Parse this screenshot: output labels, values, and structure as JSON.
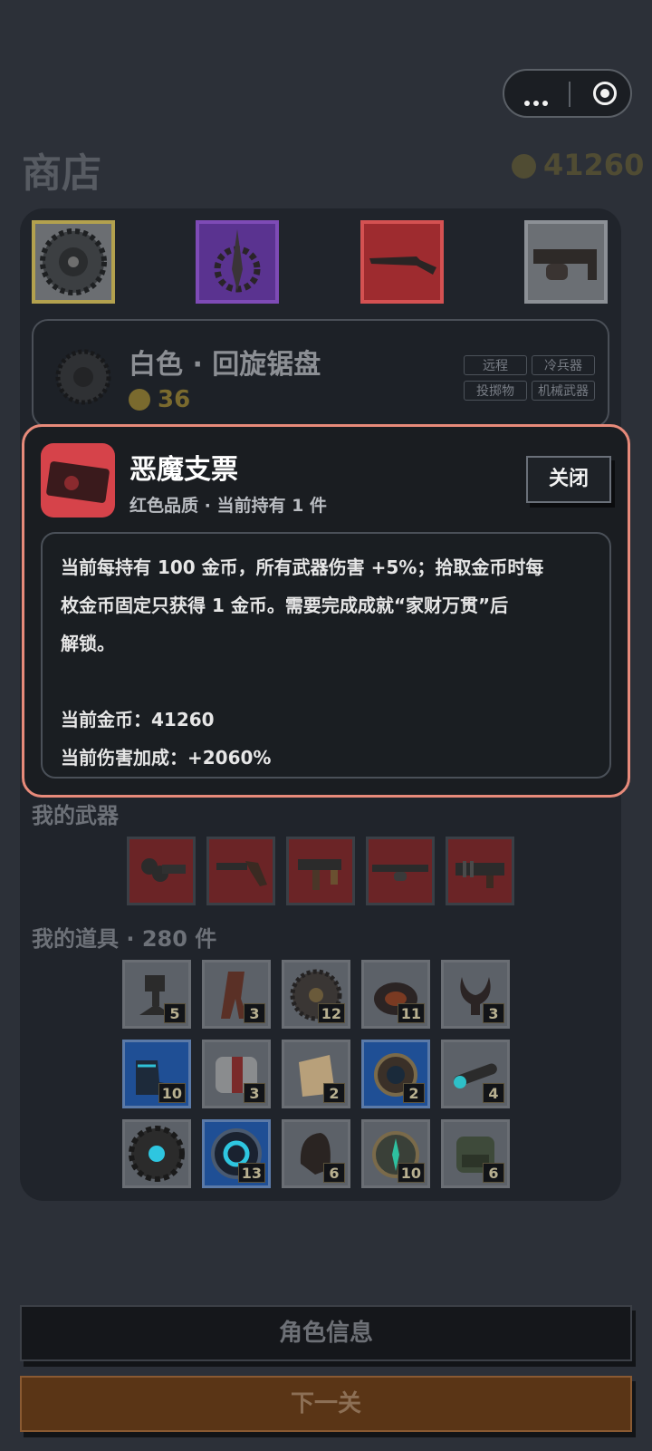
{
  "header": {
    "capsule_menu": "more-dots-icon",
    "capsule_close": "target-icon",
    "shop_title": "商店",
    "coins": "41260"
  },
  "shop": {
    "slots": [
      {
        "name": "saw-blade",
        "border": "#b3a14e",
        "bg": "#6b6e72"
      },
      {
        "name": "dagger-emblem",
        "border": "#7e4bb6",
        "bg": "#5a3390"
      },
      {
        "name": "shotgun",
        "border": "#d45152",
        "bg": "#9e2b2f"
      },
      {
        "name": "heavy-gun",
        "border": "#8c9096",
        "bg": "#6b6f74"
      }
    ],
    "selected": {
      "name": "白色 · 回旋锯盘",
      "price": "36",
      "tags": [
        "远程",
        "冷兵器",
        "投掷物",
        "机械武器"
      ]
    }
  },
  "modal": {
    "item_name": "恶魔支票",
    "subtitle": "红色品质 · 当前持有 1 件",
    "close_label": "关闭",
    "desc_line1": "当前每持有 100 金币，所有武器伤害 +5%；拾取金币时每",
    "desc_line2": "枚金币固定只获得 1 金币。需要完成成就“家财万贯”后",
    "desc_line3": "解锁。",
    "coins_line": "当前金币：41260",
    "damage_line": "当前伤害加成：+2060%"
  },
  "weapons": {
    "label": "我的武器",
    "items": [
      "drum-launcher",
      "revolver",
      "smg",
      "shotgun",
      "plasma-gun"
    ]
  },
  "items": {
    "label": "我的道具 · 280 件",
    "grid": [
      {
        "icon": "turret",
        "count": "5",
        "blue": false
      },
      {
        "icon": "scarf",
        "count": "3",
        "blue": false
      },
      {
        "icon": "gear-disc",
        "count": "12",
        "blue": false
      },
      {
        "icon": "bag",
        "count": "11",
        "blue": false
      },
      {
        "icon": "horns",
        "count": "3",
        "blue": false
      },
      {
        "icon": "boots",
        "count": "10",
        "blue": true
      },
      {
        "icon": "canister",
        "count": "3",
        "blue": false
      },
      {
        "icon": "pouch",
        "count": "2",
        "blue": false
      },
      {
        "icon": "scope-ring",
        "count": "2",
        "blue": true
      },
      {
        "icon": "rifle-scope",
        "count": "4",
        "blue": false
      },
      {
        "icon": "cog-core",
        "count": "",
        "blue": false
      },
      {
        "icon": "energy-orb",
        "count": "13",
        "blue": true
      },
      {
        "icon": "helmet",
        "count": "6",
        "blue": false
      },
      {
        "icon": "compass",
        "count": "10",
        "blue": false
      },
      {
        "icon": "backpack",
        "count": "6",
        "blue": false
      }
    ]
  },
  "buttons": {
    "role_info": "角色信息",
    "next_level": "下一关"
  }
}
